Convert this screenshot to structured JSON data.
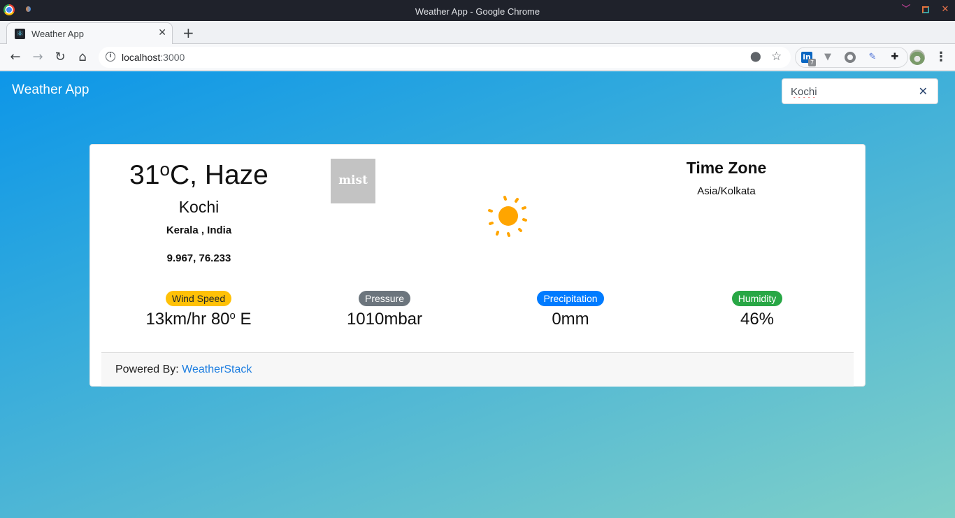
{
  "window": {
    "title": "Weather App - Google Chrome"
  },
  "tabs": [
    {
      "title": "Weather App",
      "favicon": "react-icon"
    }
  ],
  "toolbar": {
    "url_host": "localhost",
    "url_port": ":3000",
    "extensions": [
      "linkedin-icon",
      "vue-devtools-icon",
      "circle-extension-icon",
      "color-picker-icon",
      "puzzle-icon"
    ],
    "linkedin_badge": "7"
  },
  "app": {
    "brand": "Weather App",
    "search": {
      "value": "Kochi",
      "placeholder": ""
    }
  },
  "weather": {
    "temperature": "31",
    "temp_unit": "C",
    "degree_symbol": "o",
    "condition": "Haze",
    "city": "Kochi",
    "region": "Kerala , India",
    "coordinates": "9.967, 76.233",
    "icon_image_text": "mist",
    "timezone_title": "Time Zone",
    "timezone": "Asia/Kolkata",
    "colors": {
      "sun": "#ffa500"
    }
  },
  "stats": [
    {
      "label": "Wind Speed",
      "value_prefix": "13km/hr 80",
      "value_suffix": " E",
      "sup": "o",
      "badge_bg": "#ffc107",
      "badge_fg": "#212529"
    },
    {
      "label": "Pressure",
      "value": "1010mbar",
      "badge_bg": "#6c757d",
      "badge_fg": "#ffffff"
    },
    {
      "label": "Precipitation",
      "value": "0mm",
      "badge_bg": "#007bff",
      "badge_fg": "#ffffff"
    },
    {
      "label": "Humidity",
      "value": "46%",
      "badge_bg": "#28a745",
      "badge_fg": "#ffffff"
    }
  ],
  "footer": {
    "powered_label": "Powered By: ",
    "link_text": "WeatherStack"
  }
}
